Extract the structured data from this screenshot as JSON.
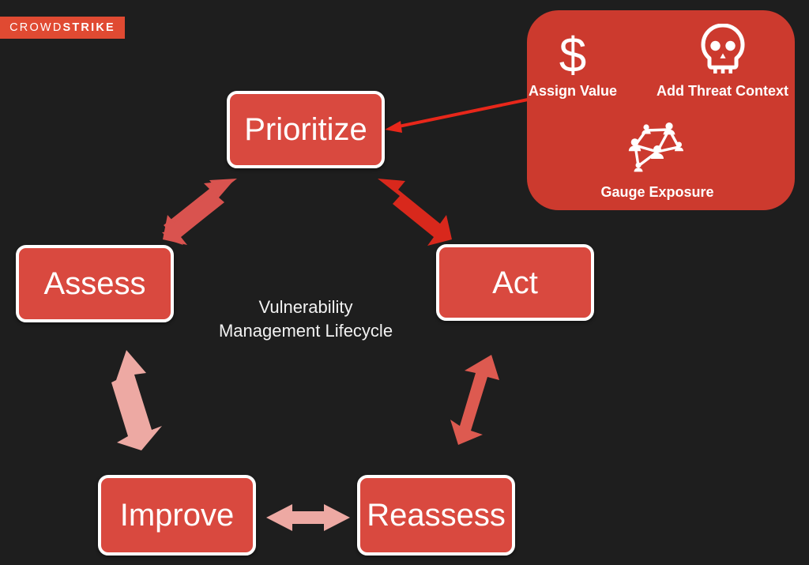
{
  "brand": {
    "logo_light": "CROWD",
    "logo_bold": "STRIKE",
    "logo_banner_color": "#e04a32"
  },
  "canvas": {
    "background_color": "#1e1e1e"
  },
  "diagram": {
    "center_caption_line1": "Vulnerability",
    "center_caption_line2": "Management Lifecycle",
    "box_fill_color": "#d9493f",
    "box_border_color": "#ffffff",
    "stages": [
      {
        "id": "prioritize",
        "label": "Prioritize"
      },
      {
        "id": "assess",
        "label": "Assess"
      },
      {
        "id": "act",
        "label": "Act"
      },
      {
        "id": "improve",
        "label": "Improve"
      },
      {
        "id": "reassess",
        "label": "Reassess"
      }
    ],
    "connectors": [
      {
        "id": "assess-prioritize",
        "style": "double-headed",
        "color": "#d9534f"
      },
      {
        "id": "prioritize-act",
        "style": "double-headed",
        "color": "#d8281c"
      },
      {
        "id": "assess-improve",
        "style": "double-headed",
        "color": "#eda9a3"
      },
      {
        "id": "act-reassess",
        "style": "double-headed",
        "color": "#dd5a50"
      },
      {
        "id": "improve-reassess",
        "style": "double-headed",
        "color": "#eda9a3"
      },
      {
        "id": "callout-to-prioritize",
        "style": "single-headed-line",
        "color": "#e8271a"
      }
    ]
  },
  "callout": {
    "background_color": "#cc3a2e",
    "items": [
      {
        "id": "assign-value",
        "icon": "dollar-sign-icon",
        "glyph": "$",
        "label": "Assign Value"
      },
      {
        "id": "add-threat-context",
        "icon": "skull-icon",
        "label": "Add Threat Context"
      },
      {
        "id": "gauge-exposure",
        "icon": "network-nodes-icon",
        "label": "Gauge Exposure"
      }
    ]
  }
}
